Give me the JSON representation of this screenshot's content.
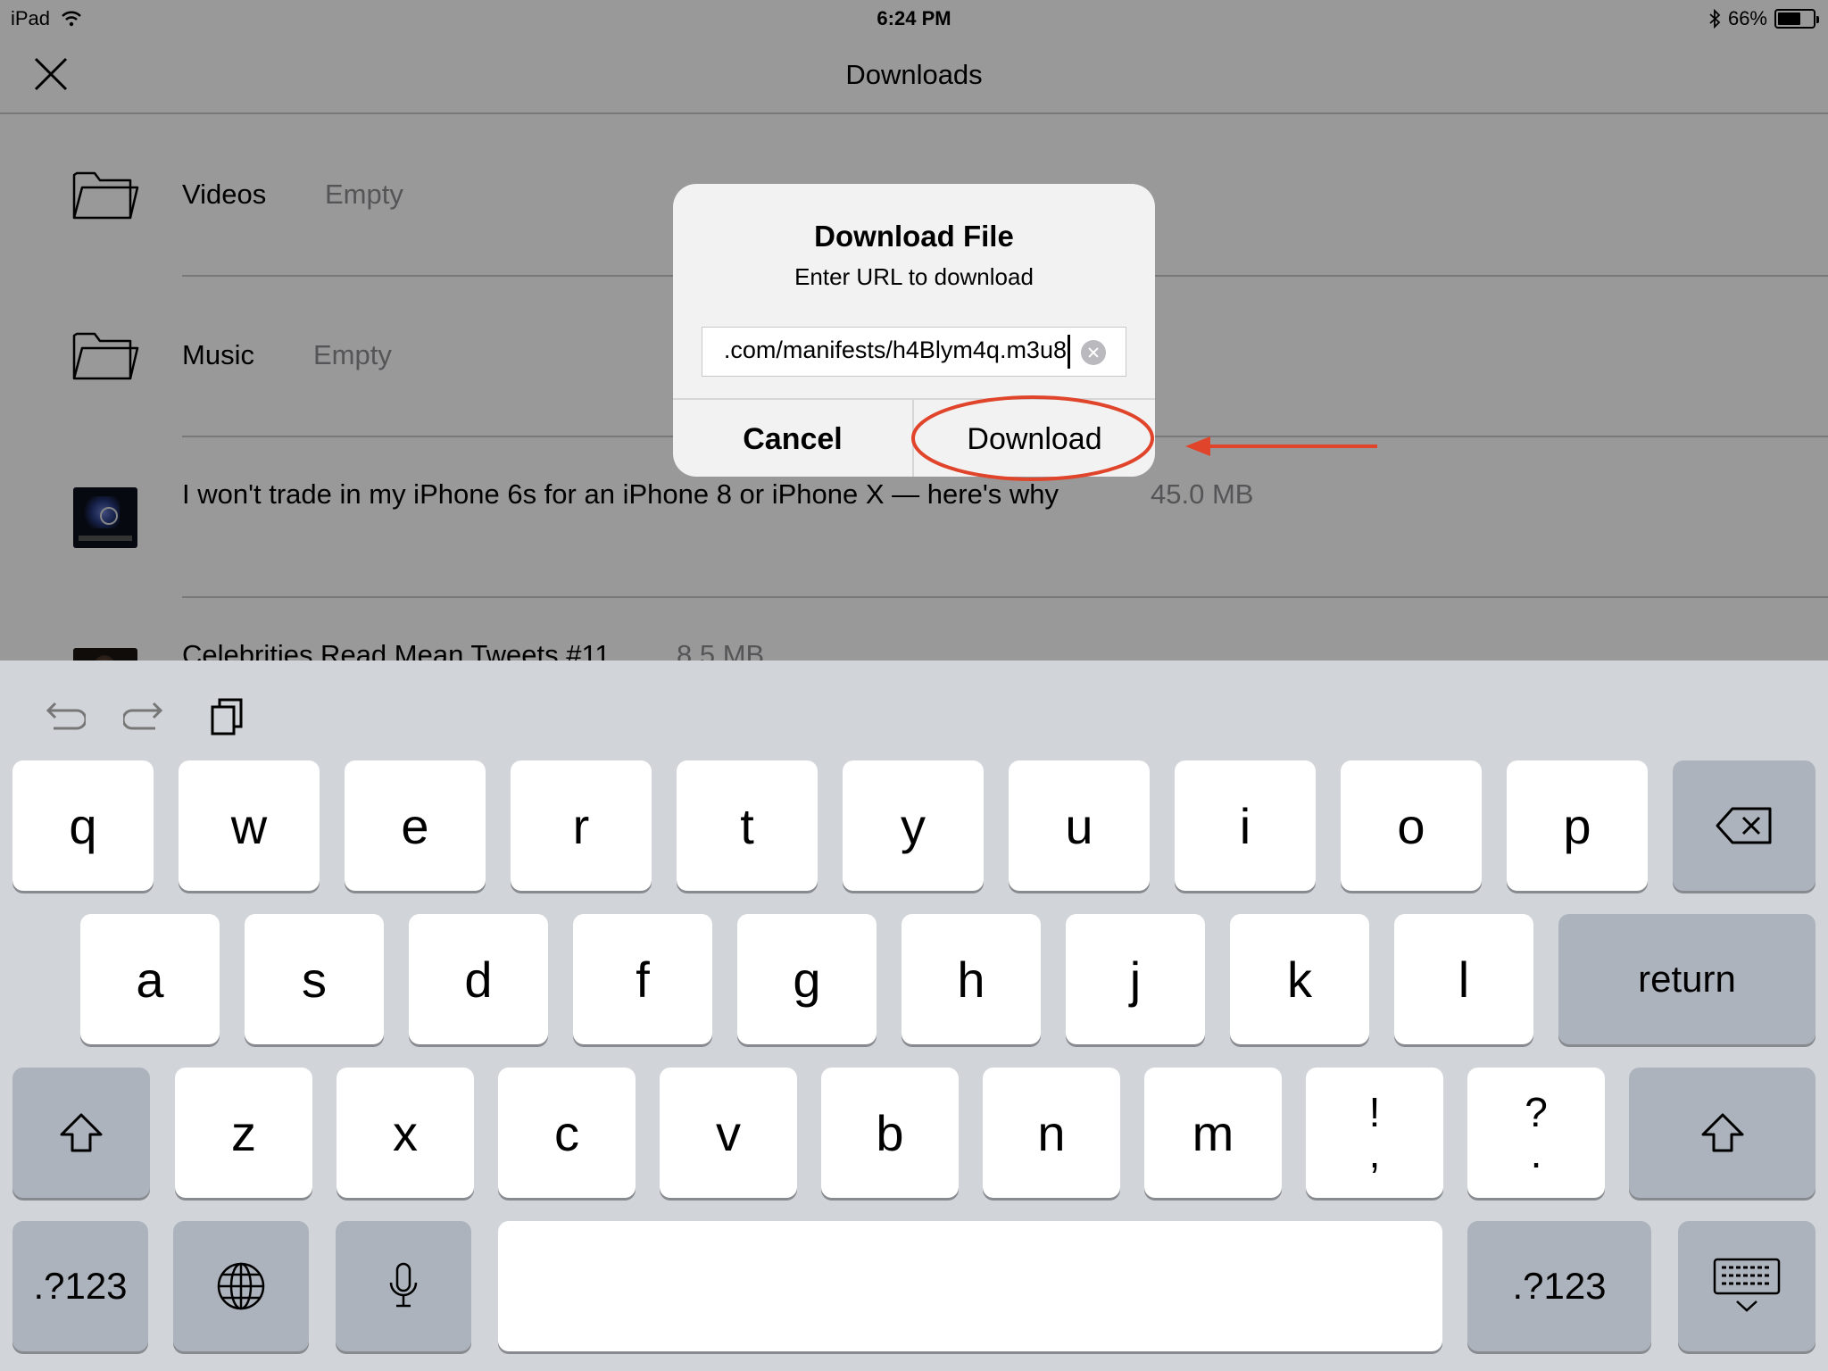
{
  "status_bar": {
    "device": "iPad",
    "time": "6:24 PM",
    "battery": "66%",
    "battery_level": 0.66
  },
  "nav": {
    "title": "Downloads"
  },
  "list": {
    "folders": [
      {
        "name": "Videos",
        "status": "Empty"
      },
      {
        "name": "Music",
        "status": "Empty"
      }
    ],
    "files": [
      {
        "title": "I won't trade in my iPhone 6s for an iPhone 8 or iPhone X — here's why",
        "size": "45.0 MB",
        "thumb": "video-thumbnail"
      },
      {
        "title": "Celebrities Read Mean Tweets #11",
        "size": "8.5 MB",
        "thumb": "video-thumbnail"
      }
    ]
  },
  "alert": {
    "title": "Download File",
    "message": "Enter URL to download",
    "url_value": ".com/manifests/h4Blym4q.m3u8",
    "cancel_label": "Cancel",
    "download_label": "Download"
  },
  "annotation": {
    "color": "#e0442a"
  },
  "keyboard": {
    "row1": [
      "q",
      "w",
      "e",
      "r",
      "t",
      "y",
      "u",
      "i",
      "o",
      "p"
    ],
    "row2": [
      "a",
      "s",
      "d",
      "f",
      "g",
      "h",
      "j",
      "k",
      "l"
    ],
    "row3": [
      "z",
      "x",
      "c",
      "v",
      "b",
      "n",
      "m"
    ],
    "punct1": {
      "top": "!",
      "bottom": ","
    },
    "punct2": {
      "top": "?",
      "bottom": "."
    },
    "return_label": "return",
    "numbers_label": ".?123",
    "icons": [
      "undo-icon",
      "redo-icon",
      "paste-icon",
      "backspace-icon",
      "shift-icon",
      "globe-icon",
      "microphone-icon",
      "keyboard-dismiss-icon"
    ]
  }
}
